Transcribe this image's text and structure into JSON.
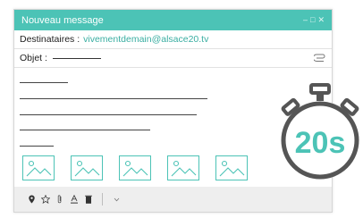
{
  "window": {
    "title": "Nouveau message",
    "controls": [
      "–",
      "□",
      "✕"
    ]
  },
  "recipients": {
    "label": "Destinataires :",
    "value": "vivementdemain@alsace20.tv"
  },
  "subject": {
    "label": "Objet :"
  },
  "body": {
    "image_count": 5
  },
  "toolbar": {
    "icons": [
      "location-icon",
      "star-icon",
      "attach-icon",
      "text-format-icon",
      "trash-icon",
      "more-icon"
    ]
  },
  "timer": {
    "label": "20s"
  },
  "colors": {
    "accent": "#4cc3b6",
    "timer_dark": "#555555"
  }
}
